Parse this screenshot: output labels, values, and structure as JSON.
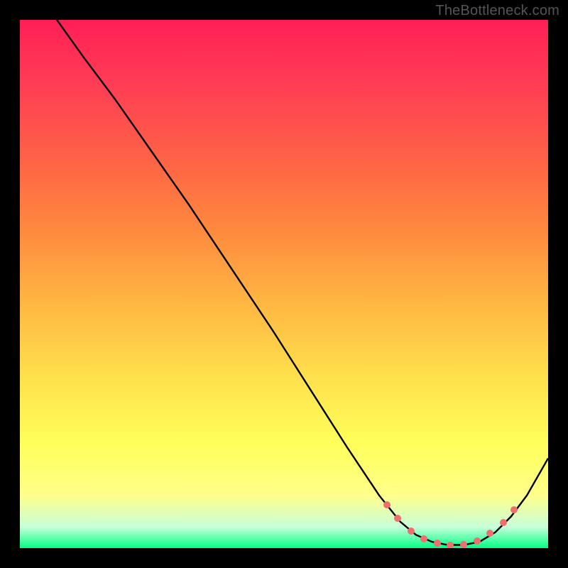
{
  "watermark": "TheBottleneck.com",
  "chart_data": {
    "type": "line",
    "title": "",
    "xlabel": "",
    "ylabel": "",
    "xlim": [
      0,
      100
    ],
    "ylim": [
      0,
      100
    ],
    "series": [
      {
        "name": "curve",
        "x": [
          0,
          7,
          12,
          18,
          25,
          32,
          40,
          48,
          55,
          62,
          68,
          72,
          75,
          78,
          81,
          84,
          87,
          90,
          93,
          96,
          100
        ],
        "y": [
          108,
          100,
          93,
          85,
          75,
          65,
          53,
          41,
          30,
          19,
          10,
          5,
          2.5,
          1.2,
          0.6,
          0.6,
          1.2,
          3,
          6,
          10,
          17
        ]
      }
    ],
    "markers": {
      "name": "range-dots",
      "x": [
        69.5,
        71.5,
        74,
        76.5,
        79,
        81.5,
        84,
        86.5,
        89,
        91.5,
        93.5
      ],
      "y": [
        8.2,
        5.6,
        3.2,
        1.8,
        0.9,
        0.6,
        0.7,
        1.4,
        2.8,
        4.8,
        7.2
      ]
    },
    "gradient_colors": [
      "#ff1f55",
      "#ff6146",
      "#ffb843",
      "#ffff5a",
      "#00ff84"
    ]
  }
}
